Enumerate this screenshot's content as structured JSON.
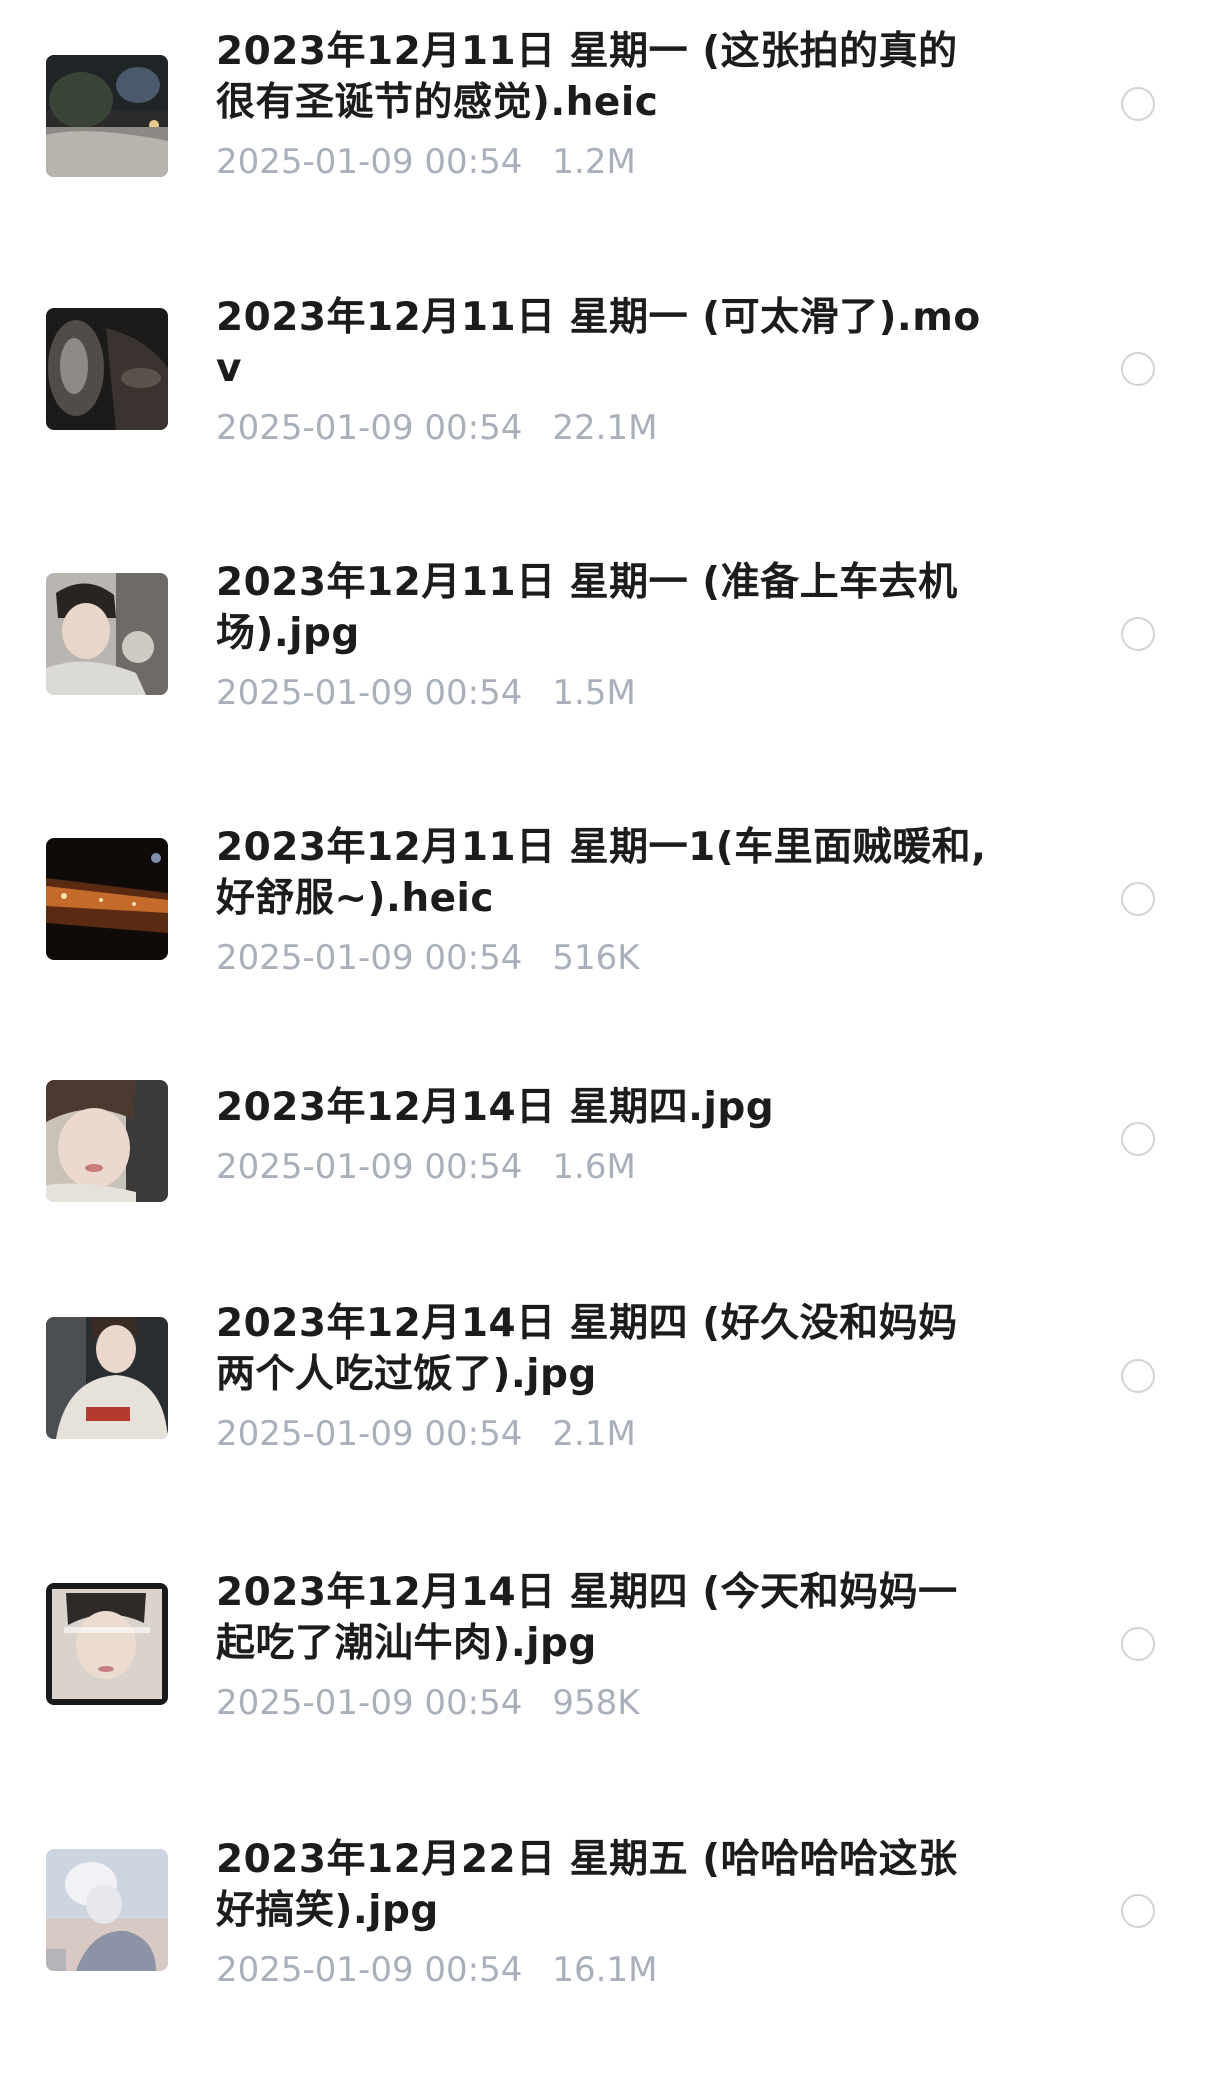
{
  "files": [
    {
      "name": "2023年12月11日 星期一 (这张拍的真的很有圣诞节的感觉).heic",
      "date": "2025-01-09 00:54",
      "size": "1.2M",
      "thumb_icon": "snowy-garden-night-photo-thumbnail",
      "selected": false
    },
    {
      "name": "2023年12月11日 星期一 (可太滑了).mov",
      "date": "2025-01-09 00:54",
      "size": "22.1M",
      "thumb_icon": "dark-video-thumbnail",
      "selected": false
    },
    {
      "name": "2023年12月11日 星期一 (准备上车去机场).jpg",
      "date": "2025-01-09 00:54",
      "size": "1.5M",
      "thumb_icon": "selfie-in-car-thumbnail",
      "selected": false
    },
    {
      "name": "2023年12月11日 星期一1(车里面贼暖和,好舒服~).heic",
      "date": "2025-01-09 00:54",
      "size": "516K",
      "thumb_icon": "night-street-lights-thumbnail",
      "selected": false
    },
    {
      "name": "2023年12月14日 星期四.jpg",
      "date": "2025-01-09 00:54",
      "size": "1.6M",
      "thumb_icon": "selfie-closeup-thumbnail",
      "selected": false
    },
    {
      "name": "2023年12月14日 星期四 (好久没和妈妈两个人吃过饭了).jpg",
      "date": "2025-01-09 00:54",
      "size": "2.1M",
      "thumb_icon": "hoodie-selfie-thumbnail",
      "selected": false
    },
    {
      "name": "2023年12月14日 星期四 (今天和妈妈一起吃了潮汕牛肉).jpg",
      "date": "2025-01-09 00:54",
      "size": "958K",
      "thumb_icon": "framed-portrait-thumbnail",
      "selected": false
    },
    {
      "name": "2023年12月22日 星期五 (哈哈哈哈这张好搞笑).jpg",
      "date": "2025-01-09 00:54",
      "size": "16.1M",
      "thumb_icon": "sky-smoke-photo-thumbnail",
      "selected": false
    }
  ],
  "colors": {
    "title": "#1c1c1e",
    "meta": "#a9b0bc",
    "radio_border": "#cfd4da"
  }
}
